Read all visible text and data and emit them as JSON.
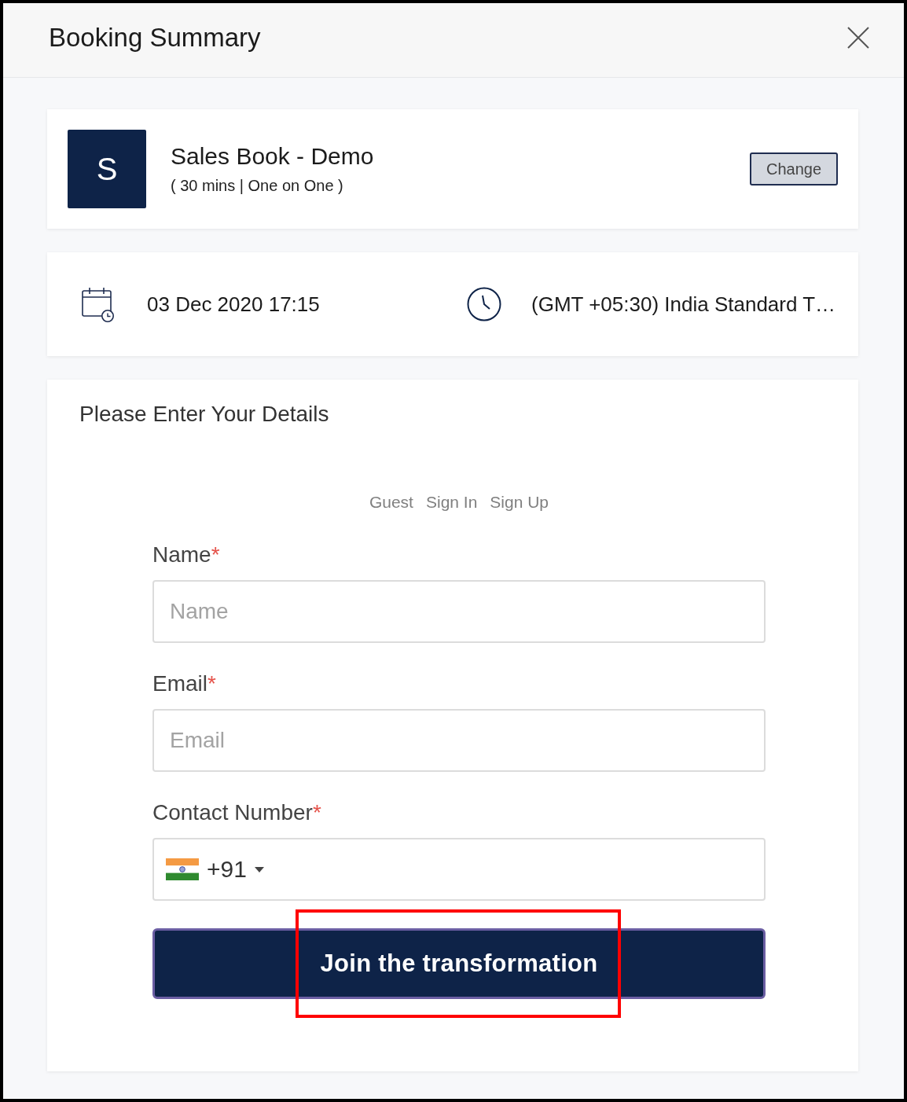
{
  "dialog": {
    "title": "Booking Summary"
  },
  "event": {
    "initial": "S",
    "title": "Sales Book - Demo",
    "details": "( 30 mins | One on One )",
    "change_button": "Change"
  },
  "schedule": {
    "date_time": "03 Dec 2020 17:15",
    "timezone": "(GMT +05:30) India Standard T…"
  },
  "details_form": {
    "heading": "Please Enter Your Details",
    "tabs": [
      {
        "label": "Guest",
        "selected": false
      },
      {
        "label": "Sign In",
        "selected": false
      },
      {
        "label": "Sign Up",
        "selected": false
      }
    ],
    "fields": [
      {
        "kind": "text",
        "label": "Name",
        "required_mark": "*",
        "placeholder": "Name"
      },
      {
        "kind": "text",
        "label": "Email",
        "required_mark": "*",
        "placeholder": "Email"
      },
      {
        "kind": "phone",
        "label": "Contact Number",
        "required_mark": "*",
        "dial_code": "+91"
      }
    ],
    "submit": {
      "label": "Join the transformation",
      "highlighted": true
    }
  }
}
